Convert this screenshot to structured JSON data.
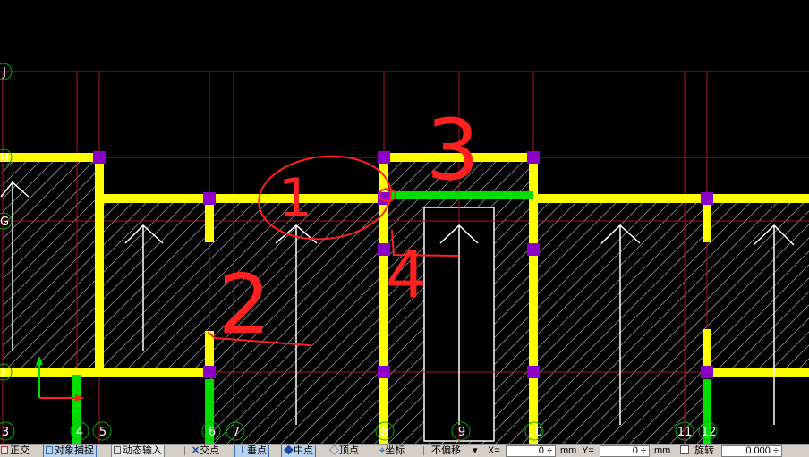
{
  "colors": {
    "background": "#000000",
    "axis_line": "#b0141f",
    "wall": "#ffff00",
    "column": "#8a00c8",
    "beam_highlight": "#00dd00",
    "hatch": "#a0a0a0",
    "annotation": "#ff2020",
    "axis_label": "#ffffff",
    "axis_bubble": "#00aa00"
  },
  "grid": {
    "vertical_labels": [
      "3",
      "4",
      "5",
      "6",
      "7",
      "8",
      "9",
      "10",
      "11",
      "12"
    ],
    "horizontal_labels": [
      "J",
      "H",
      "G",
      "F"
    ]
  },
  "annotations": {
    "mark_1": "1",
    "mark_2": "2",
    "mark_3": "3",
    "mark_4": "4"
  },
  "statusbar": {
    "ortho": "正交",
    "object_snap": "对象捕捉",
    "dynamic_input": "动态输入",
    "intersection": "交点",
    "perpendicular": "垂点",
    "midpoint": "中点",
    "vertex": "顶点",
    "coordinate": "坐标",
    "offset_mode": "不偏移",
    "x_label": "X=",
    "x_value": "0",
    "mm1": "mm",
    "y_label": "Y=",
    "y_value": "0",
    "mm2": "mm",
    "rotate_label": "旋转",
    "rotate_value": "0.000"
  }
}
